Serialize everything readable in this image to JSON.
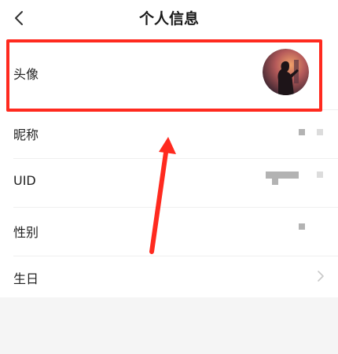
{
  "header": {
    "title": "个人信息"
  },
  "rows": {
    "avatar_label": "头像",
    "nickname_label": "昵称",
    "uid_label": "UID",
    "gender_label": "性别",
    "birthday_label": "生日"
  },
  "colors": {
    "highlight": "#ff2a1f",
    "background": "#f5f5f5",
    "surface": "#ffffff"
  }
}
